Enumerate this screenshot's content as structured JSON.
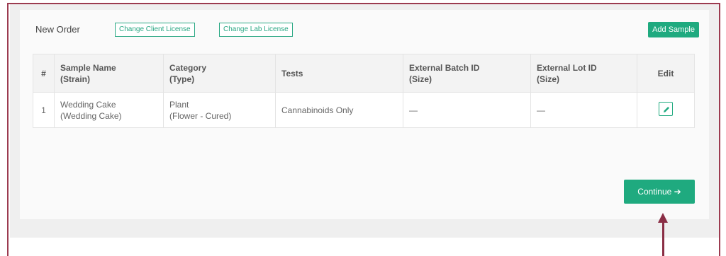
{
  "header": {
    "title": "New Order",
    "change_client_license": "Change Client License",
    "change_lab_license": "Change Lab License",
    "add_sample": "Add Sample"
  },
  "table": {
    "columns": {
      "num": "#",
      "sample_name": "Sample Name",
      "sample_name_sub": "(Strain)",
      "category": "Category",
      "category_sub": "(Type)",
      "tests": "Tests",
      "external_batch": "External Batch ID",
      "external_batch_sub": "(Size)",
      "external_lot": "External Lot ID",
      "external_lot_sub": "(Size)",
      "edit": "Edit"
    },
    "rows": [
      {
        "num": "1",
        "sample_name": "Wedding Cake",
        "strain": "(Wedding Cake)",
        "category": "Plant",
        "type": "(Flower - Cured)",
        "tests": "Cannabinoids Only",
        "external_batch": "—",
        "external_lot": "—"
      }
    ]
  },
  "footer": {
    "continue": "Continue ➔"
  },
  "colors": {
    "accent": "#1faa7f",
    "frame": "#9c3b50",
    "arrow": "#8a2e45"
  },
  "icons": {
    "edit": "pencil-icon",
    "pointer": "arrow-up-icon"
  }
}
